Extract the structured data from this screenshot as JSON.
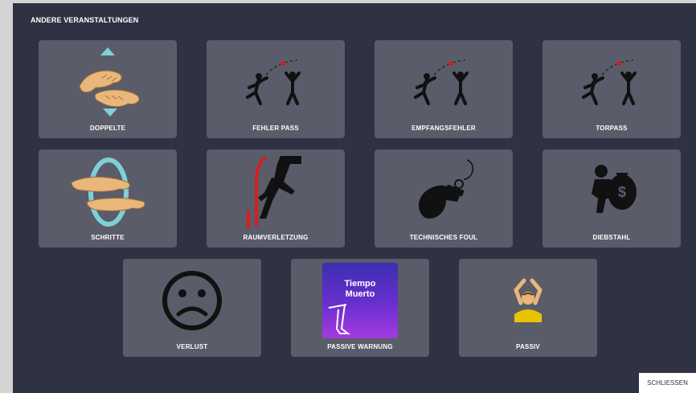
{
  "dialog": {
    "title": "ANDERE VERANSTALTUNGEN",
    "close_label": "SCHLIESSEN"
  },
  "tiles": [
    {
      "label": "DOPPELTE",
      "icon": "double-dribble-hands-icon"
    },
    {
      "label": "FEHLER PASS",
      "icon": "bad-pass-players-icon"
    },
    {
      "label": "EMPFANGSFEHLER",
      "icon": "receiving-error-players-icon"
    },
    {
      "label": "TORPASS",
      "icon": "assist-players-icon"
    },
    {
      "label": "SCHRITTE",
      "icon": "traveling-hands-icon"
    },
    {
      "label": "RAUMVERLETZUNG",
      "icon": "area-violation-runner-icon"
    },
    {
      "label": "TECHNISCHES FOUL",
      "icon": "whistle-icon"
    },
    {
      "label": "DIEBSTAHL",
      "icon": "thief-money-bag-icon"
    },
    {
      "label": "VERLUST",
      "icon": "sad-face-icon"
    },
    {
      "label": "PASSIVE WARNUNG",
      "icon": "timeout-card-icon",
      "card_text": "Tiempo Muerto"
    },
    {
      "label": "PASSIV",
      "icon": "passive-referee-icon"
    }
  ],
  "colors": {
    "background": "#2f3242",
    "tile": "#5a5c6a",
    "accent_red": "#d32020",
    "accent_cyan": "#7fd0d6",
    "card_purple": "#8a2be2"
  }
}
